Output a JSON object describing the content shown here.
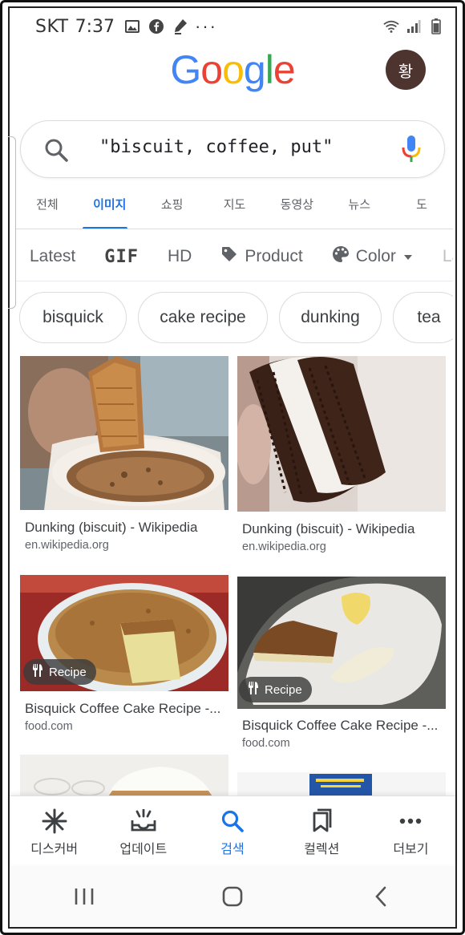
{
  "status_bar": {
    "carrier": "SKT",
    "time": "7:37",
    "left_icons": [
      "image-icon",
      "facebook-icon",
      "pen-icon"
    ],
    "overflow": "···",
    "right_icons": [
      "wifi-icon",
      "signal-icon",
      "battery-icon"
    ]
  },
  "header": {
    "logo": [
      "G",
      "o",
      "o",
      "g",
      "l",
      "e"
    ],
    "logo_colors": [
      "#4285F4",
      "#EA4335",
      "#FBBC05",
      "#4285F4",
      "#34A853",
      "#EA4335"
    ],
    "avatar_letter": "황",
    "avatar_color": "#4e342e"
  },
  "search": {
    "query": "\"biscuit, coffee, put\""
  },
  "tabs": {
    "items": [
      {
        "label": "전체"
      },
      {
        "label": "이미지"
      },
      {
        "label": "쇼핑"
      },
      {
        "label": "지도"
      },
      {
        "label": "동영상"
      },
      {
        "label": "뉴스"
      },
      {
        "label": "도"
      }
    ],
    "active_index": 1,
    "accent": "#1a73e8"
  },
  "filters": {
    "latest": "Latest",
    "gif": "GIF",
    "hd": "HD",
    "product": "Product",
    "color": "Color",
    "more": "La"
  },
  "chips": [
    "bisquick",
    "cake recipe",
    "dunking",
    "tea"
  ],
  "results": [
    {
      "title": "Dunking (biscuit) - Wikipedia",
      "source": "en.wikipedia.org",
      "badge": ""
    },
    {
      "title": "Dunking (biscuit) - Wikipedia",
      "source": "en.wikipedia.org",
      "badge": ""
    },
    {
      "title": "Bisquick Coffee Cake Recipe -...",
      "source": "food.com",
      "badge": "Recipe"
    },
    {
      "title": "Bisquick Coffee Cake Recipe -...",
      "source": "food.com",
      "badge": "Recipe"
    }
  ],
  "bottom_nav": {
    "items": [
      {
        "label": "디스커버",
        "icon": "asterisk-icon"
      },
      {
        "label": "업데이트",
        "icon": "updates-icon"
      },
      {
        "label": "검색",
        "icon": "search-icon"
      },
      {
        "label": "컬렉션",
        "icon": "bookmarks-icon"
      },
      {
        "label": "더보기",
        "icon": "more-dots-icon"
      }
    ],
    "active_index": 2
  }
}
